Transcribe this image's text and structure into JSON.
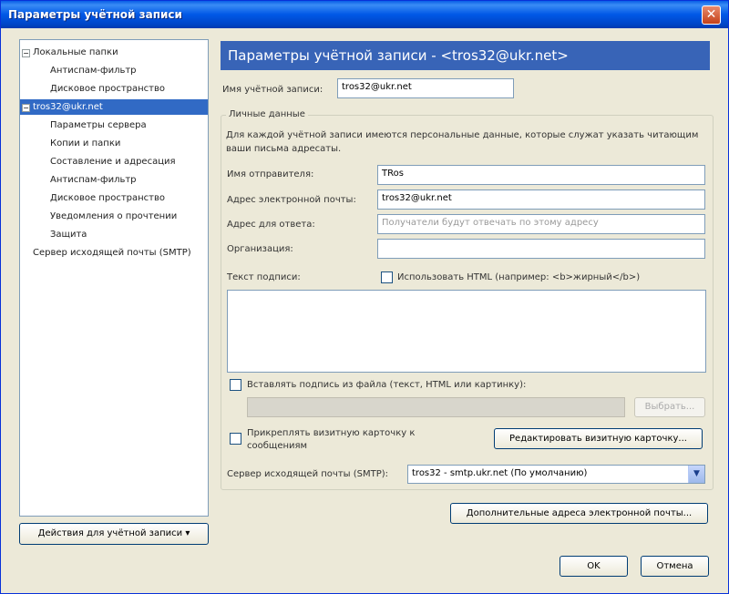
{
  "window": {
    "title": "Параметры учётной записи",
    "close_icon": "close-icon"
  },
  "tree": {
    "local_folders": "Локальные папки",
    "local_spam": "Антиспам-фильтр",
    "local_disk": "Дисковое пространство",
    "account": "tros32@ukr.net",
    "server_settings": "Параметры сервера",
    "copies_folders": "Копии и папки",
    "composition": "Составление и адресация",
    "spam": "Антиспам-фильтр",
    "disk": "Дисковое пространство",
    "receipts": "Уведомления о прочтении",
    "security": "Защита",
    "smtp": "Сервер исходящей почты (SMTP)"
  },
  "actions_button": "Действия для учётной записи",
  "header": "Параметры учётной записи - <tros32@ukr.net>",
  "account_name_label": "Имя учётной записи:",
  "account_name_value": "tros32@ukr.net",
  "personal": {
    "title": "Личные данные",
    "description": "Для каждой учётной записи имеются персональные данные, которые служат указать читающим ваши письма адресаты.",
    "sender_label": "Имя отправителя:",
    "sender_value": "TRos",
    "email_label": "Адрес электронной почты:",
    "email_value": "tros32@ukr.net",
    "reply_label": "Адрес для ответа:",
    "reply_placeholder": "Получатели будут отвечать по этому адресу",
    "org_label": "Организация:",
    "org_value": ""
  },
  "signature": {
    "label": "Текст подписи:",
    "html_checkbox": "Использовать HTML (например: <b>жирный</b>)",
    "file_checkbox": "Вставлять подпись из файла (текст, HTML или картинку):",
    "choose_button": "Выбрать...",
    "vcard_checkbox": "Прикреплять визитную карточку к сообщениям",
    "edit_vcard_button": "Редактировать визитную карточку..."
  },
  "smtp_label": "Сервер исходящей почты (SMTP):",
  "smtp_value": "tros32 - smtp.ukr.net (По умолчанию)",
  "dropdown_icon": "chevron-down-icon",
  "extra_emails_button": "Дополнительные адреса электронной почты...",
  "ok_button": "OK",
  "cancel_button": "Отмена"
}
